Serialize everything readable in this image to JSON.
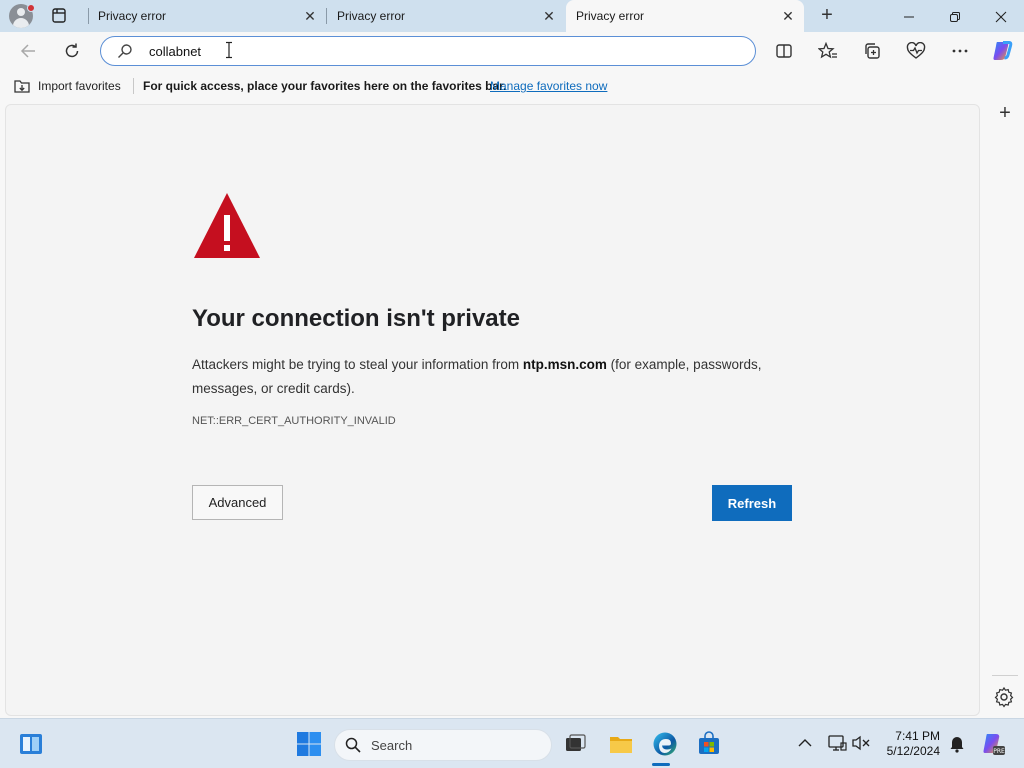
{
  "tabs": [
    {
      "title": "Privacy error",
      "active": false
    },
    {
      "title": "Privacy error",
      "active": false
    },
    {
      "title": "Privacy error",
      "active": true
    }
  ],
  "address_bar": {
    "value": "collabnet",
    "placeholder": ""
  },
  "favorites_bar": {
    "import_label": "Import favorites",
    "message": "For quick access, place your favorites here on the favorites bar.",
    "manage_link": "Manage favorites now"
  },
  "error_page": {
    "title": "Your connection isn't private",
    "desc_prefix": "Attackers might be trying to steal your information from ",
    "host": "ntp.msn.com",
    "desc_suffix": " (for example, passwords, messages, or credit cards).",
    "error_code": "NET::ERR_CERT_AUTHORITY_INVALID",
    "advanced_button": "Advanced",
    "refresh_button": "Refresh"
  },
  "taskbar": {
    "search_label": "Search",
    "time": "7:41 PM",
    "date": "5/12/2024"
  },
  "colors": {
    "accent": "#0f6cbd",
    "warning_red": "#c50f1f"
  }
}
